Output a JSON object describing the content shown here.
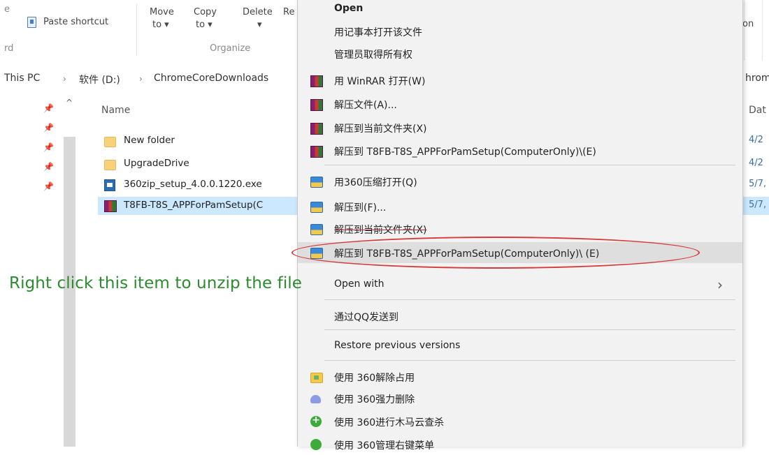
{
  "ribbon": {
    "clipboard_partial_top": "e",
    "paste_shortcut_label": "Paste shortcut",
    "clipboard_partial_bottom": "rd",
    "move_to_label": "Move",
    "move_to_sub": "to ▾",
    "copy_to_label": "Copy",
    "copy_to_sub": "to ▾",
    "delete_label": "Delete",
    "delete_sub": "▾",
    "rename_partial": "Re",
    "organize_label": "Organize",
    "right_partial": "on"
  },
  "address": {
    "this_pc": "This PC",
    "drive": "软件 (D:)",
    "folder": "ChromeCoreDownloads",
    "right_partial": "hrom"
  },
  "nav": {
    "pins": [
      "📌",
      "📌",
      "📌",
      "📌",
      "📌"
    ],
    "scroll_up": "^"
  },
  "files": {
    "column_name": "Name",
    "items": [
      {
        "name": "New folder",
        "icon": "folder-icon"
      },
      {
        "name": "UpgradeDrive",
        "icon": "folder-icon"
      },
      {
        "name": "360zip_setup_4.0.0.1220.exe",
        "icon": "exe-icon"
      },
      {
        "name": "T8FB-T8S_APPForPamSetup(C",
        "icon": "rar-icon",
        "selected": true
      }
    ]
  },
  "right_column": {
    "header": "Dat",
    "dates": [
      "4/2",
      "4/2",
      "5/7,",
      "5/7,"
    ]
  },
  "annotation": "Right click this item to unzip the file",
  "context_menu": {
    "items": [
      {
        "label": "Open",
        "bold": true
      },
      {
        "label": "用记事本打开该文件"
      },
      {
        "label": "管理员取得所有权"
      },
      {
        "label": "用 WinRAR 打开(W)",
        "icon": "winrar-icon"
      },
      {
        "label": "解压文件(A)...",
        "icon": "winrar-icon"
      },
      {
        "label": "解压到当前文件夹(X)",
        "icon": "winrar-icon"
      },
      {
        "label": "解压到 T8FB-T8S_APPForPamSetup(ComputerOnly)\\(E)",
        "icon": "winrar-icon"
      },
      {
        "label": "用360压缩打开(Q)",
        "icon": "360zip-icon"
      },
      {
        "label": "解压到(F)...",
        "icon": "360zip-icon"
      },
      {
        "label": "解压到当前文件夹(X)",
        "icon": "360zip-icon"
      },
      {
        "label": "解压到 T8FB-T8S_APPForPamSetup(ComputerOnly)\\ (E)",
        "icon": "360zip-icon",
        "highlighted": true
      },
      {
        "label": "Open with"
      },
      {
        "label": "通过QQ发送到"
      },
      {
        "label": "Restore previous versions"
      },
      {
        "label": "使用 360解除占用",
        "icon": "360-unlock-icon"
      },
      {
        "label": "使用 360强力删除",
        "icon": "360-shred-icon"
      },
      {
        "label": "使用 360进行木马云查杀",
        "icon": "360-scan-icon"
      },
      {
        "label": "使用 360管理右键菜单",
        "icon": "360-manage-icon"
      }
    ],
    "chevron": "›"
  },
  "colors": {
    "highlight_ellipse": "#d63a3a",
    "annotation": "#2c8a2f",
    "selection": "#cce8ff",
    "menu_bg": "#f2f2f2"
  }
}
